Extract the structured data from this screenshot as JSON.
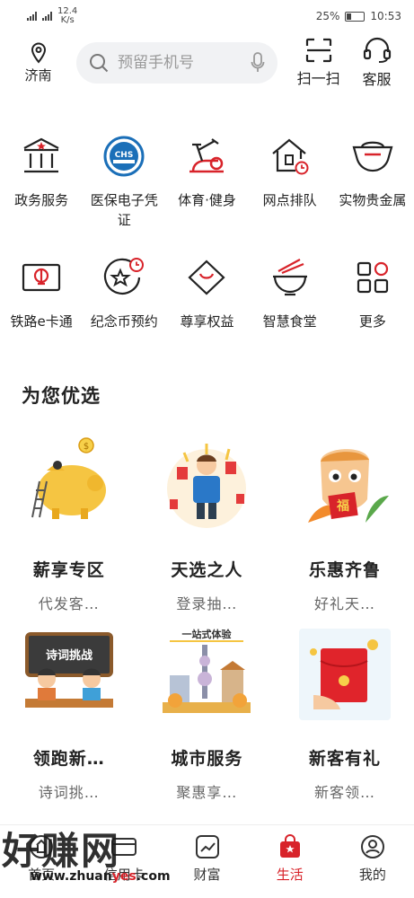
{
  "status": {
    "net_speed": "12.4",
    "net_unit": "K/s",
    "battery": "25%",
    "time": "10:53"
  },
  "header": {
    "location": "济南",
    "search_placeholder": "预留手机号",
    "scan_label": "扫一扫",
    "service_label": "客服"
  },
  "services_row1": [
    {
      "label": "政务服务",
      "icon": "government-building-icon"
    },
    {
      "label": "医保电子凭证",
      "icon": "chs-medical-insurance-icon"
    },
    {
      "label": "体育·健身",
      "icon": "exercise-bike-icon"
    },
    {
      "label": "网点排队",
      "icon": "branch-queue-icon"
    },
    {
      "label": "实物贵金属",
      "icon": "gold-ingot-icon"
    }
  ],
  "services_row2": [
    {
      "label": "铁路e卡通",
      "icon": "railway-card-icon"
    },
    {
      "label": "纪念币预约",
      "icon": "coin-reservation-icon"
    },
    {
      "label": "尊享权益",
      "icon": "diamond-icon"
    },
    {
      "label": "智慧食堂",
      "icon": "noodle-bowl-icon"
    },
    {
      "label": "更多",
      "icon": "more-grid-icon"
    }
  ],
  "section_title": "为您优选",
  "promos": [
    {
      "title": "薪享专区",
      "subtitle": "代发客…"
    },
    {
      "title": "天选之人",
      "subtitle": "登录抽…"
    },
    {
      "title": "乐惠齐鲁",
      "subtitle": "好礼天…"
    },
    {
      "title": "领跑新…",
      "subtitle": "诗词挑…",
      "art_text": "诗词挑战"
    },
    {
      "title": "城市服务",
      "subtitle": "聚惠享…",
      "art_text": "一站式体验"
    },
    {
      "title": "新客有礼",
      "subtitle": "新客领…"
    }
  ],
  "nav": [
    {
      "label": "首页",
      "active": false
    },
    {
      "label": "信用卡",
      "active": false
    },
    {
      "label": "财富",
      "active": false
    },
    {
      "label": "生活",
      "active": true
    },
    {
      "label": "我的",
      "active": false
    }
  ],
  "watermark": {
    "text": "好赚网",
    "url_a": "www.zhuan",
    "url_b": "yes",
    "url_c": ".com"
  },
  "colors": {
    "accent": "#d8232a",
    "text": "#222222",
    "muted": "#666666",
    "search_bg": "#f1f2f4"
  }
}
